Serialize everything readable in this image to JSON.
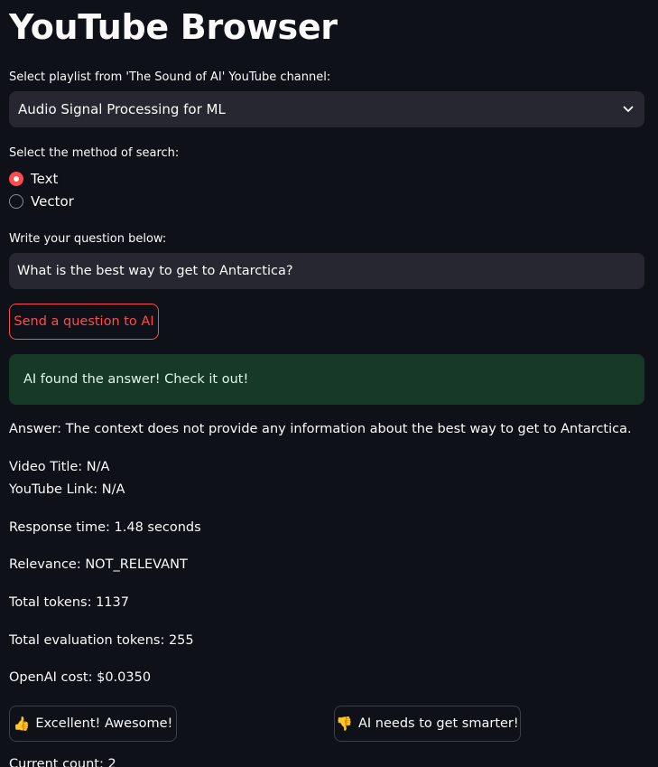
{
  "app": {
    "title": "YouTube Browser"
  },
  "playlist": {
    "label": "Select playlist from 'The Sound of AI' YouTube channel:",
    "selected": "Audio Signal Processing for ML",
    "icon": "chevron-down-icon"
  },
  "search_method": {
    "label": "Select the method of search:",
    "options": [
      {
        "label": "Text",
        "selected": true
      },
      {
        "label": "Vector",
        "selected": false
      }
    ]
  },
  "question": {
    "label": "Write your question below:",
    "value": "What is the best way to get to Antarctica?"
  },
  "send_button": {
    "label": "Send a question to AI"
  },
  "alert": {
    "message": "AI found the answer! Check it out!"
  },
  "results": {
    "answer": "Answer: The context does not provide any information about the best way to get to Antarctica.",
    "video_title": "Video Title: N/A",
    "youtube_link": "YouTube Link: N/A",
    "response_time": "Response time: 1.48 seconds",
    "relevance": "Relevance: NOT_RELEVANT",
    "total_tokens": "Total tokens: 1137",
    "eval_tokens": "Total evaluation tokens: 255",
    "openai_cost": "OpenAI cost: $0.0350"
  },
  "feedback": {
    "positive_icon": "👍",
    "positive_label": "Excellent! Awesome!",
    "negative_icon": "👎",
    "negative_label": "AI needs to get smarter!"
  },
  "counter": {
    "text": "Current count: 2"
  },
  "colors": {
    "background": "#0e1117",
    "accent": "#ff4b4b",
    "input_bg": "#262730",
    "success_bg": "#173928"
  }
}
